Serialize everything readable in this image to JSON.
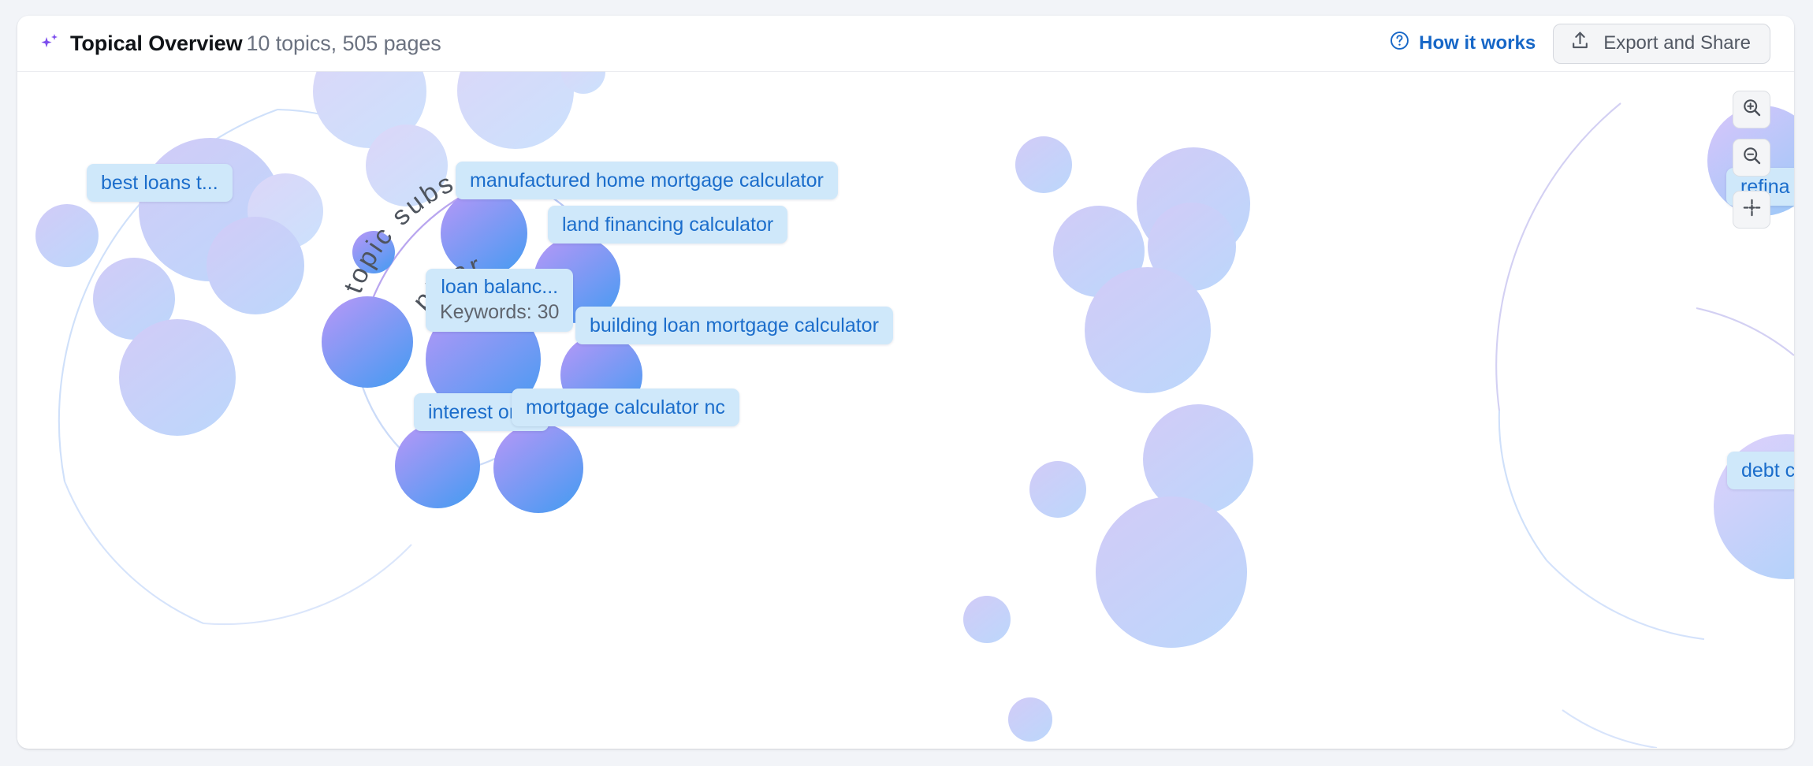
{
  "header": {
    "sparkle_icon": "sparkle-icon",
    "title": "Topical Overview",
    "subtitle": "10 topics, 505 pages",
    "how_it_works": {
      "icon": "question-circle-icon",
      "label": "How it works"
    },
    "export": {
      "icon": "upload-icon",
      "label": "Export and Share"
    }
  },
  "canvas": {
    "curved_labels": [
      {
        "name": "topic-subs-arc-label",
        "text": "topic subs"
      },
      {
        "name": "pillar-arc-label",
        "text": "pillar"
      }
    ],
    "nodes": [
      {
        "name": "node-best-loans",
        "label": "best loans t...",
        "keywords": ""
      },
      {
        "name": "node-manufactured-home",
        "label": "manufactured home mortgage calculator",
        "keywords": ""
      },
      {
        "name": "node-land-financing",
        "label": "land financing calculator",
        "keywords": ""
      },
      {
        "name": "node-loan-balance",
        "label": "loan balanc...",
        "keywords": "Keywords: 30"
      },
      {
        "name": "node-building-loan",
        "label": "building loan mortgage calculator",
        "keywords": ""
      },
      {
        "name": "node-interest-only",
        "label": "interest only",
        "keywords": ""
      },
      {
        "name": "node-mortgage-calculator-nc",
        "label": "mortgage calculator nc",
        "keywords": ""
      },
      {
        "name": "node-refinance",
        "label": "refina",
        "keywords": ""
      },
      {
        "name": "node-debt-consolidation",
        "label": "debt consoli...",
        "keywords": ""
      }
    ],
    "controls": [
      {
        "name": "zoom-in-button",
        "icon": "zoom-in-icon"
      },
      {
        "name": "zoom-out-button",
        "icon": "zoom-out-icon"
      },
      {
        "name": "recenter-button",
        "icon": "crosshair-icon"
      }
    ]
  },
  "colors": {
    "label_bg": "#cfe8fa",
    "label_text": "#1b6dcb",
    "link_text": "#1767c7",
    "bubble_purple": "#b49bf5",
    "bubble_blue": "#589cf0",
    "bubble_faded_purple": "#cdc9f5",
    "bubble_faded_blue": "#c4d8fb",
    "sparkle": "#7c4ded",
    "card_bg": "#ffffff",
    "page_bg": "#f2f4f8"
  }
}
